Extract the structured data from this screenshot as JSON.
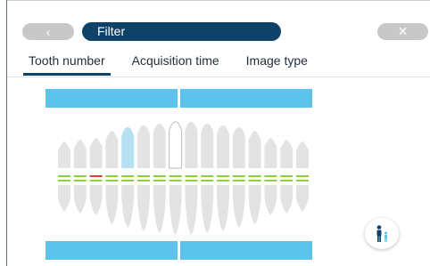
{
  "header": {
    "back_icon": "chevron-left-icon",
    "back_glyph": "‹",
    "title": "Filter",
    "close_icon": "close-icon",
    "close_glyph": "✕"
  },
  "tabs": [
    {
      "label": "Tooth number",
      "active": true
    },
    {
      "label": "Acquisition time",
      "active": false
    },
    {
      "label": "Image type",
      "active": false
    }
  ],
  "tooth_chart": {
    "upper_teeth_count": 16,
    "lower_teeth_count": 16,
    "highlighted_upper": [
      4
    ],
    "outlined_upper": [
      7
    ],
    "red_marker_index": 2,
    "colors": {
      "bar": "#5bc3ec",
      "tooth": "#e3e3e3",
      "highlight": "#b6e1f2",
      "marker_green": "#8bd13c",
      "marker_red": "#e03a3a"
    }
  },
  "avatar_button": {
    "icon": "adult-child-icon"
  },
  "colors": {
    "title_pill": "#0f4268",
    "grey_button": "#c8c8c8",
    "tab_underline": "#0f4268"
  }
}
